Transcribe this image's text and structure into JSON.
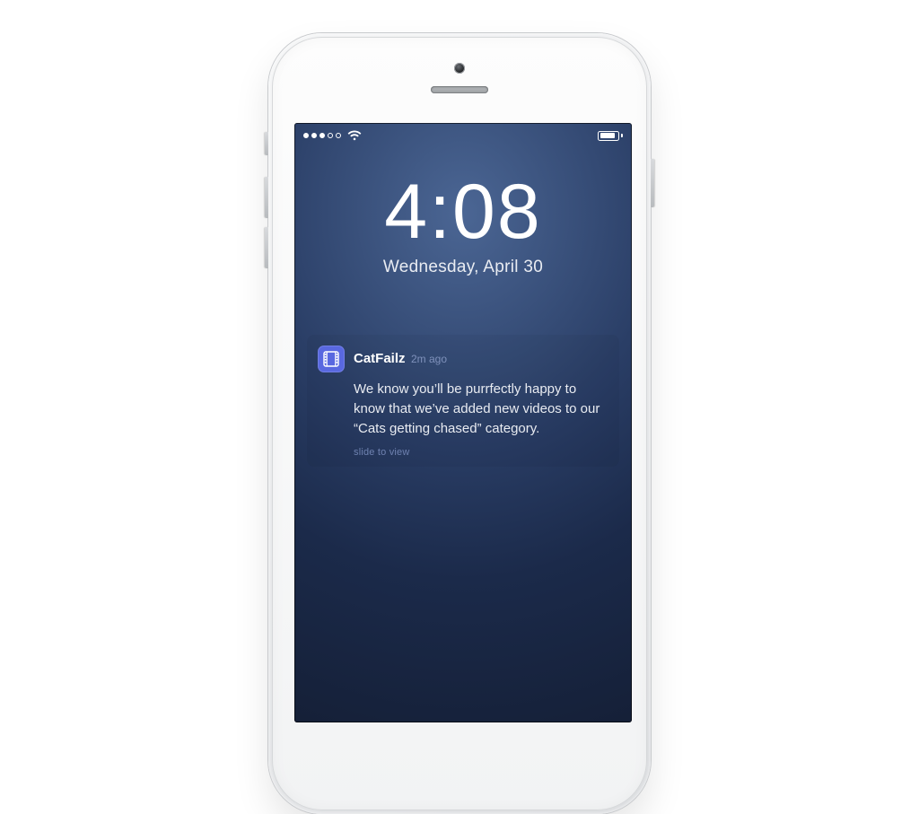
{
  "lockscreen": {
    "time": "4:08",
    "date": "Wednesday, April 30"
  },
  "status": {
    "signal_bars_filled": 3,
    "signal_bars_total": 5,
    "wifi": true,
    "battery_percent": 75
  },
  "notification": {
    "app_name": "CatFailz",
    "age": "2m ago",
    "body": "We know you’ll be purrfectly happy to know that we’ve added new videos to our “Cats getting chased” category.",
    "hint": "slide to view",
    "icon_color": "#5968e0"
  }
}
